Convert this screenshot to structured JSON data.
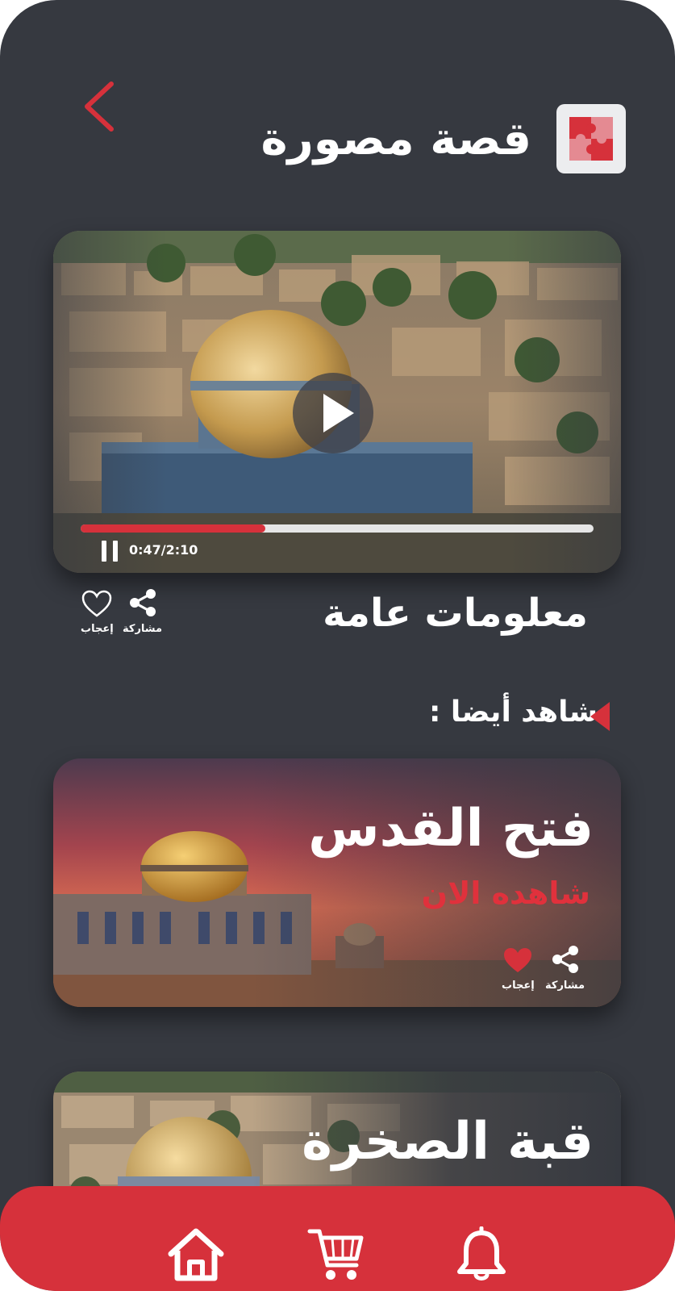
{
  "header": {
    "title": "قصة مصورة",
    "back_icon": "chevron-left-icon",
    "logo_icon": "puzzle-icon"
  },
  "video": {
    "current_time": "0:47/2:10",
    "progress": 0.36,
    "play_icon": "play-icon",
    "pause_icon": "pause-icon"
  },
  "info": {
    "title": "معلومات عامة",
    "share_label": "مشاركة",
    "like_label": "إعجاب"
  },
  "see_also": {
    "label": "شاهد أيضا :",
    "cards": [
      {
        "title": "فتح القدس",
        "cta": "شاهده الان",
        "share_label": "مشاركة",
        "like_label": "إعجاب",
        "liked": true
      },
      {
        "title": "قبة الصخرة"
      }
    ]
  },
  "nav": {
    "items": [
      "home-icon",
      "cart-icon",
      "bell-icon"
    ]
  },
  "colors": {
    "background": "#363940",
    "accent": "#d6313b",
    "text": "#ffffff"
  }
}
